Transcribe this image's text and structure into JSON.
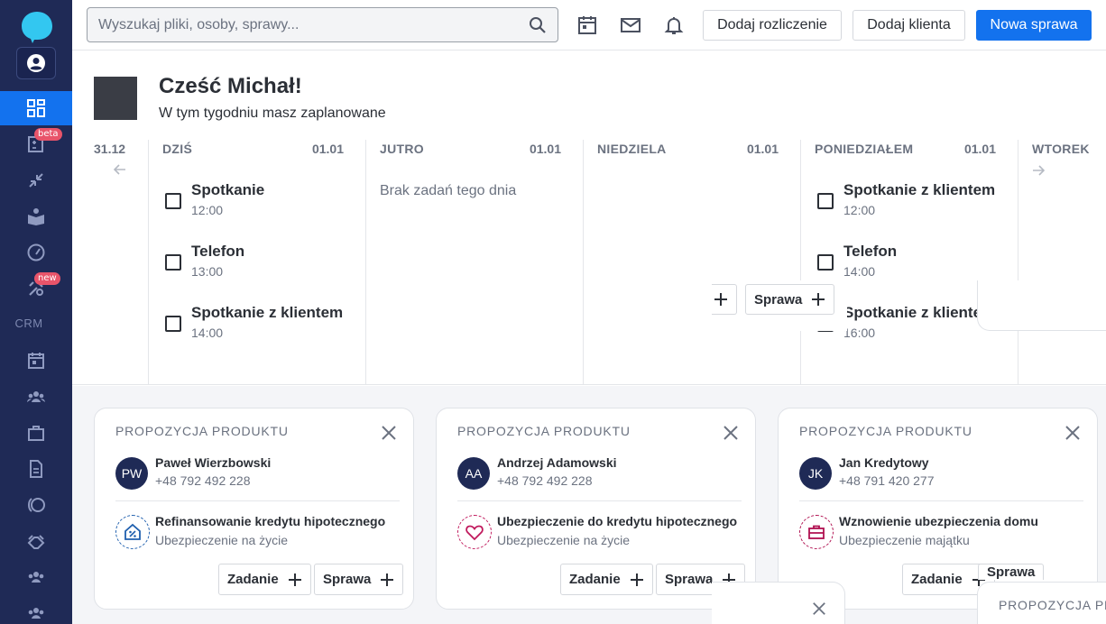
{
  "search": {
    "placeholder": "Wyszukaj pliki, osoby, sprawy..."
  },
  "topbar": {
    "add_settlement": "Dodaj rozliczenie",
    "add_client": "Dodaj klienta",
    "new_case": "Nowa sprawa"
  },
  "sidebar": {
    "badge_beta": "beta",
    "badge_new": "new",
    "crm_label": "CRM"
  },
  "greeting": {
    "title": "Cześć Michał!",
    "subtitle": "W tym tygodniu masz zaplanowane"
  },
  "week": {
    "prev_date": "31.12",
    "empty_text": "Brak zadań tego dnia",
    "days": [
      {
        "name": "DZIŚ",
        "date": "01.01",
        "tasks": [
          {
            "title": "Spotkanie",
            "time": "12:00"
          },
          {
            "title": "Telefon",
            "time": "13:00"
          },
          {
            "title": "Spotkanie z klientem",
            "time": "14:00"
          }
        ]
      },
      {
        "name": "JUTRO",
        "date": "01.01"
      },
      {
        "name": "NIEDZIELA",
        "date": "01.01"
      },
      {
        "name": "PONIEDZIAŁEM",
        "date": "01.01",
        "tasks": [
          {
            "title": "Spotkanie z klientem",
            "time": "12:00"
          },
          {
            "title": "Telefon",
            "time": "14:00"
          },
          {
            "title": "Spotkanie z klientem",
            "time": "16:00"
          }
        ]
      },
      {
        "name": "WTOREK"
      }
    ],
    "float_case_label": "Sprawa"
  },
  "suggestions": {
    "card_title": "PROPOZYCJA PRODUKTU",
    "task_label": "Zadanie",
    "case_label": "Sprawa",
    "cards": [
      {
        "initials": "PW",
        "name": "Paweł Wierzbowski",
        "phone": "+48 792 492 228",
        "product": "Refinansowanie kredytu hipotecznego",
        "category": "Ubezpieczenie na życie",
        "icon": "house-percent-icon",
        "icon_color": "#1f5fae"
      },
      {
        "initials": "AA",
        "name": "Andrzej Adamowski",
        "phone": "+48 792 492 228",
        "product": "Ubezpieczenie do kredytu hipotecznego",
        "category": "Ubezpieczenie na życie",
        "icon": "heart-icon",
        "icon_color": "#c0185c"
      },
      {
        "initials": "JK",
        "name": "Jan Kredytowy",
        "phone": "+48 791 420 277",
        "product": "Wznowienie ubezpieczenia domu",
        "category": "Ubezpieczenie majątku",
        "icon": "briefcase-icon",
        "icon_color": "#b01050"
      }
    ],
    "partial_title": "PROPOZYCJA PR"
  },
  "colors": {
    "sidebar": "#1f2a56",
    "accent": "#1372ee",
    "badge": "#e8546a"
  }
}
